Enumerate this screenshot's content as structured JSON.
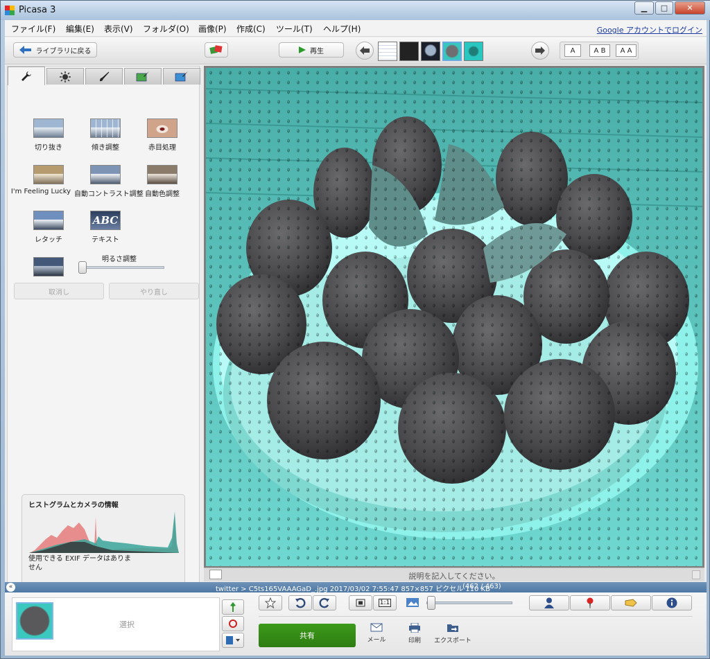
{
  "window": {
    "title": "Picasa 3",
    "minimize": "▁",
    "maximize": "□",
    "close": "✕"
  },
  "menu": {
    "items": [
      "ファイル(F)",
      "編集(E)",
      "表示(V)",
      "フォルダ(O)",
      "画像(P)",
      "作成(C)",
      "ツール(T)",
      "ヘルプ(H)"
    ],
    "login": "Google アカウントでログイン"
  },
  "toolbar": {
    "back_label": "ライブラリに戻る",
    "play_label": "再生",
    "text_size_buttons": [
      "A",
      "A B",
      "A A"
    ]
  },
  "tools": {
    "crop": "切り抜き",
    "straighten": "傾き調整",
    "redeye": "赤目処理",
    "lucky": "I'm Feeling Lucky",
    "autocontrast": "自動コントラスト調整",
    "autocolor": "自動色調整",
    "retouch": "レタッチ",
    "text": "テキスト",
    "fill_light": "明るさ調整",
    "fill_light_level": 0,
    "undo": "取消し",
    "redo": "やり直し"
  },
  "histogram": {
    "title": "ヒストグラムとカメラの情報",
    "exif": "使用できる EXIF データはありません"
  },
  "caption": {
    "placeholder": "説明を記入してください。"
  },
  "status": {
    "text": "twitter > C5ts165VAAAGaD_.jpg 2017/03/02 7:55:47 857×857 ピクセル 110 KB",
    "position": "(462 / 463)"
  },
  "tray": {
    "selection_label": "選択",
    "share": "共有",
    "mail": "メール",
    "print": "印刷",
    "export": "エクスポート"
  },
  "colors": {
    "share_green": "#2e8b15",
    "status_blue": "#4d77a3",
    "photo_cyan": "#54d8cf",
    "strawberry_gray": "#4a4a4c"
  }
}
